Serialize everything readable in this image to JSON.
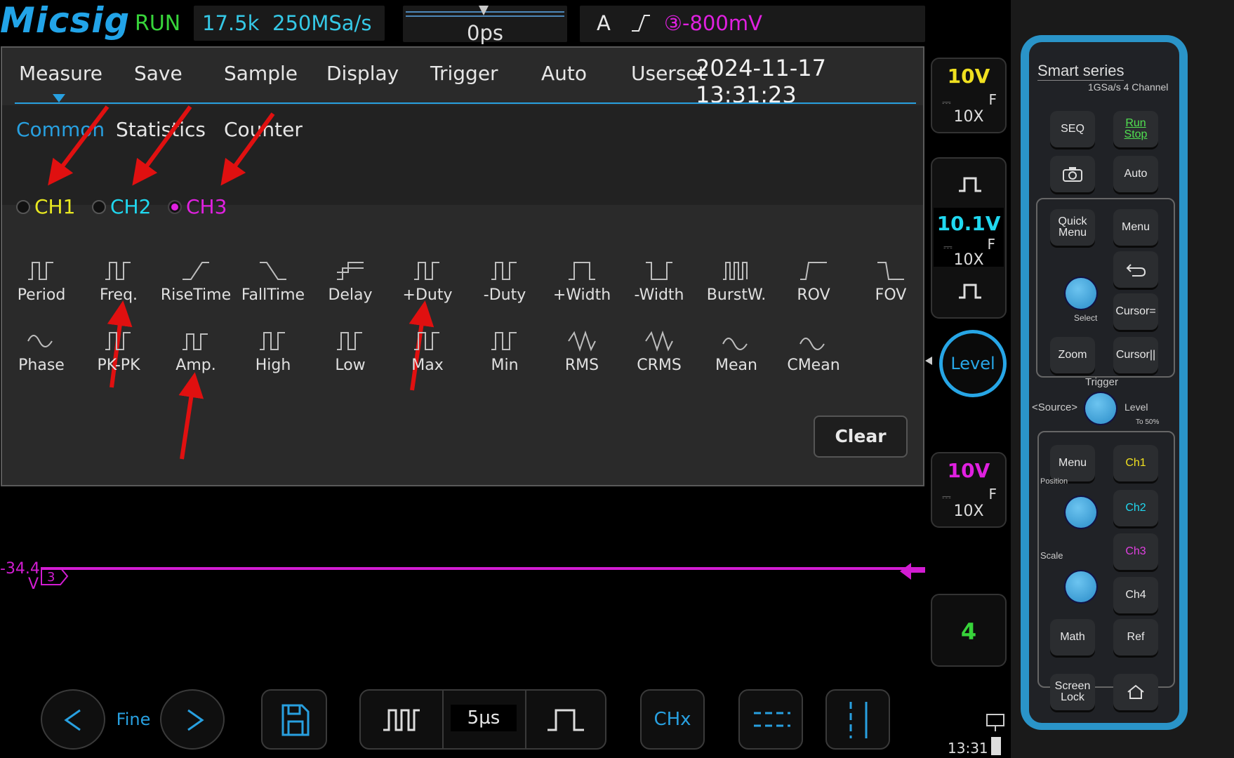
{
  "status_bar": {
    "brand": "Micsig",
    "run_state": "RUN",
    "memory_depth": "17.5k",
    "sample_rate": "250MSa/s",
    "time_position": "0ps",
    "trigger_mode": "A",
    "trigger_level": "③-800mV"
  },
  "menu": {
    "tabs": [
      "Measure",
      "Save",
      "Sample",
      "Display",
      "Trigger",
      "Auto",
      "Userset"
    ],
    "datetime": "2024-11-17 13:31:23",
    "subtabs": [
      "Common",
      "Statistics",
      "Counter"
    ],
    "channels": [
      {
        "label": "CH1",
        "color": "#e8e820",
        "selected": false
      },
      {
        "label": "CH2",
        "color": "#20d8f0",
        "selected": false
      },
      {
        "label": "CH3",
        "color": "#e020e0",
        "selected": true
      }
    ],
    "measurements_row1": [
      "Period",
      "Freq.",
      "RiseTime",
      "FallTime",
      "Delay",
      "+Duty",
      "-Duty",
      "+Width",
      "-Width",
      "BurstW.",
      "ROV",
      "FOV"
    ],
    "measurements_row2": [
      "Phase",
      "PK-PK",
      "Amp.",
      "High",
      "Low",
      "Max",
      "Min",
      "RMS",
      "CRMS",
      "Mean",
      "CMean"
    ],
    "clear_label": "Clear"
  },
  "waveform": {
    "ch3_offset_label": "-34.4",
    "ch3_offset_unit": "V",
    "ch3_marker": "3"
  },
  "channel_column": {
    "ch1": {
      "scale": "10V",
      "coupling": "F",
      "probe": "10X",
      "color": "#f0e020"
    },
    "ch2": {
      "scale": "10.1V",
      "coupling": "F",
      "probe": "10X",
      "color": "#20d8f0"
    },
    "level_label": "Level",
    "ch3": {
      "scale": "10V",
      "coupling": "F",
      "probe": "10X",
      "color": "#e020e0"
    },
    "num_channels_button": "4",
    "clock": "13:31"
  },
  "toolbar": {
    "fine_label": "Fine",
    "timebase": "5µs",
    "chx_label": "CHx"
  },
  "physical_panel": {
    "series": "Smart series",
    "spec": "1GSa/s 4 Channel",
    "buttons": {
      "seq": "SEQ",
      "run_stop": "Run\nStop",
      "auto": "Auto",
      "quick_menu": "Quick\nMenu",
      "menu": "Menu",
      "cursor_eq": "Cursor=",
      "zoom": "Zoom",
      "cursor_bar": "Cursor||",
      "ch_menu": "Menu",
      "ch1": "Ch1",
      "ch2": "Ch2",
      "ch3": "Ch3",
      "ch4": "Ch4",
      "math": "Math",
      "ref": "Ref",
      "screen_lock": "Screen\nLock"
    },
    "labels": {
      "select": "Select",
      "trigger": "Trigger",
      "source": "<Source>",
      "level": "Level",
      "to50": "To 50%",
      "position": "Position",
      "scale": "Scale"
    }
  }
}
